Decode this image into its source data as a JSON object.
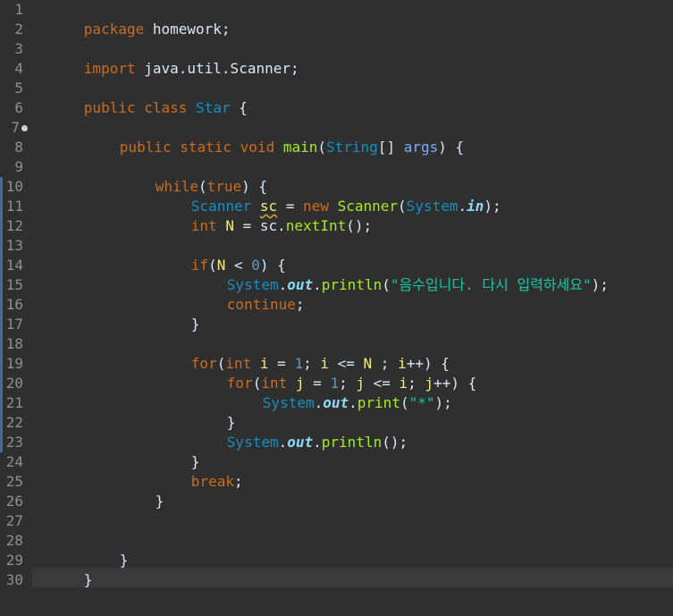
{
  "editor": {
    "line_numbers": [
      "1",
      "2",
      "3",
      "4",
      "5",
      "6",
      "7",
      "8",
      "9",
      "10",
      "11",
      "12",
      "13",
      "14",
      "15",
      "16",
      "17",
      "18",
      "19",
      "20",
      "21",
      "22",
      "23",
      "24",
      "25",
      "26",
      "27",
      "28",
      "29",
      "30"
    ],
    "colors": {
      "background": "#2f2f2f",
      "keyword": "#cc6c1d",
      "type": "#1290c3",
      "method": "#a7ec21",
      "variable": "#f3ec79",
      "string": "#17c6a3",
      "number": "#6897bb",
      "static_field": "#8dd9f8",
      "text": "#d9e8f7"
    },
    "code": {
      "l1_kw": "package",
      "l1_rest": " homework;",
      "l3_kw": "import",
      "l3_rest": " java.util.Scanner;",
      "l5_kw1": "public",
      "l5_kw2": "class",
      "l5_type": "Star",
      "l5_rest": " {",
      "l7_kw1": "public",
      "l7_kw2": "static",
      "l7_kw3": "void",
      "l7_meth": "main",
      "l7_p1": "(",
      "l7_type": "String",
      "l7_p2": "[] ",
      "l7_arg": "args",
      "l7_p3": ") {",
      "l9_kw": "while",
      "l9_p1": "(",
      "l9_kw2": "true",
      "l9_p2": ") {",
      "l10_type": "Scanner",
      "l10_var": "sc",
      "l10_eq": " = ",
      "l10_kw": "new",
      "l10_meth": "Scanner",
      "l10_p1": "(",
      "l10_type2": "System",
      "l10_dot": ".",
      "l10_field": "in",
      "l10_p2": ");",
      "l11_kw": "int",
      "l11_var": "N",
      "l11_eq": " = sc.",
      "l11_meth": "nextInt",
      "l11_p": "();",
      "l13_kw": "if",
      "l13_p1": "(",
      "l13_var": "N",
      "l13_op": " < ",
      "l13_num": "0",
      "l13_p2": ") {",
      "l14_type": "System",
      "l14_dot": ".",
      "l14_field": "out",
      "l14_dot2": ".",
      "l14_meth": "println",
      "l14_p1": "(",
      "l14_str": "\"음수입니다. 다시 입력하세요\"",
      "l14_p2": ");",
      "l15_kw": "continue",
      "l15_p": ";",
      "l16_brace": "}",
      "l18_kw": "for",
      "l18_p1": "(",
      "l18_kw2": "int",
      "l18_var": "i",
      "l18_eq": " = ",
      "l18_num": "1",
      "l18_semi": "; ",
      "l18_var2": "i",
      "l18_op": " <= ",
      "l18_var3": "N",
      "l18_semi2": " ; ",
      "l18_var4": "i",
      "l18_inc": "++) {",
      "l19_kw": "for",
      "l19_p1": "(",
      "l19_kw2": "int",
      "l19_var": "j",
      "l19_eq": " = ",
      "l19_num": "1",
      "l19_semi": "; ",
      "l19_var2": "j",
      "l19_op": " <= ",
      "l19_var3": "i",
      "l19_semi2": "; ",
      "l19_var4": "j",
      "l19_inc": "++) {",
      "l20_type": "System",
      "l20_dot": ".",
      "l20_field": "out",
      "l20_dot2": ".",
      "l20_meth": "print",
      "l20_p1": "(",
      "l20_str": "\"*\"",
      "l20_p2": ");",
      "l21_brace": "}",
      "l22_type": "System",
      "l22_dot": ".",
      "l22_field": "out",
      "l22_dot2": ".",
      "l22_meth": "println",
      "l22_p": "();",
      "l23_brace": "}",
      "l24_kw": "break",
      "l24_p": ";",
      "l25_brace": "}",
      "l28_brace": "}",
      "l29_brace": "}"
    }
  }
}
